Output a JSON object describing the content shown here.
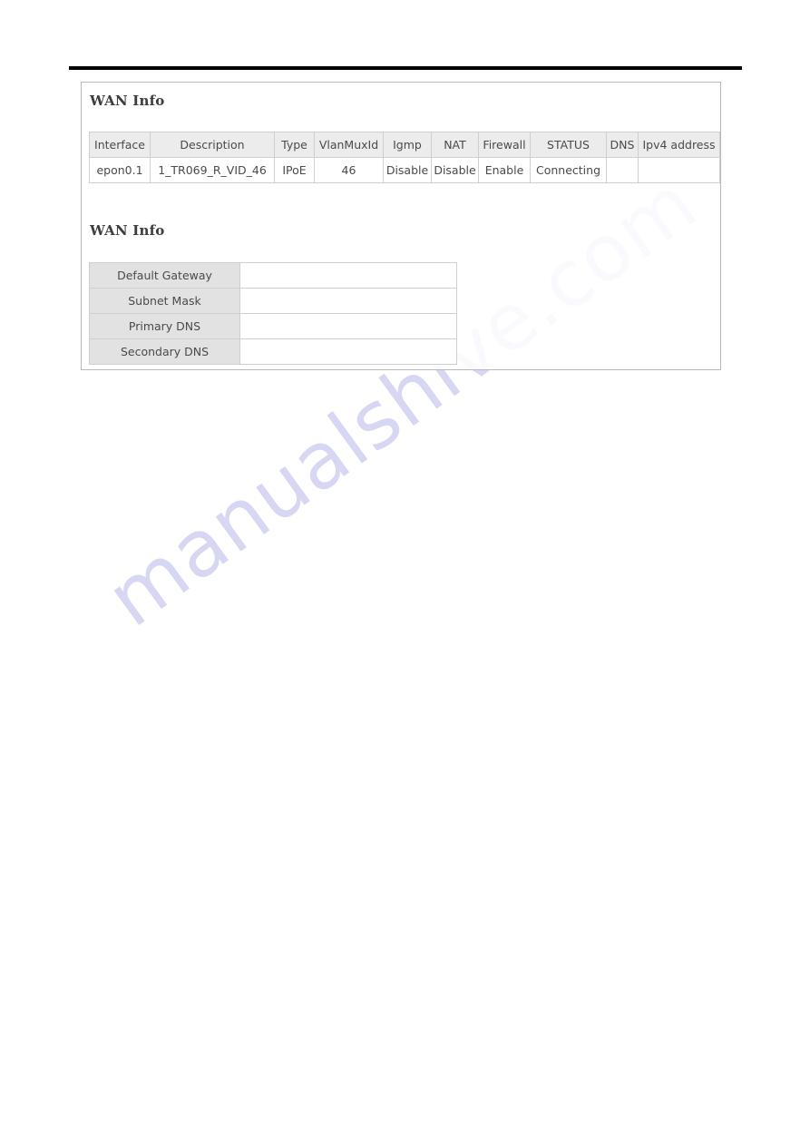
{
  "page": {
    "watermark_text": "manualshive.com",
    "watermark_color": "#ccccf0"
  },
  "panel": {
    "status_heading": "WAN Info",
    "detail_heading": "WAN Info"
  },
  "wan_status_table": {
    "columns": [
      "Interface",
      "Description",
      "Type",
      "VlanMuxId",
      "Igmp",
      "NAT",
      "Firewall",
      "STATUS",
      "DNS",
      "Ipv4 address"
    ],
    "rows": [
      {
        "interface": "epon0.1",
        "description": "1_TR069_R_VID_46",
        "type": "IPoE",
        "vlan_mux_id": "46",
        "igmp": "Disable",
        "nat": "Disable",
        "firewall": "Enable",
        "status": "Connecting",
        "dns": "",
        "ipv4_address": ""
      }
    ]
  },
  "wan_detail_table": {
    "rows": [
      {
        "label": "Default Gateway",
        "value": ""
      },
      {
        "label": "Subnet Mask",
        "value": ""
      },
      {
        "label": "Primary DNS",
        "value": ""
      },
      {
        "label": "Secondary DNS",
        "value": ""
      }
    ]
  },
  "colors": {
    "header_bg": "#ececec",
    "label_bg": "#e2e2e2",
    "border": "#cfcfcf",
    "panel_border": "#b9b9b9",
    "rule": "#000000"
  }
}
